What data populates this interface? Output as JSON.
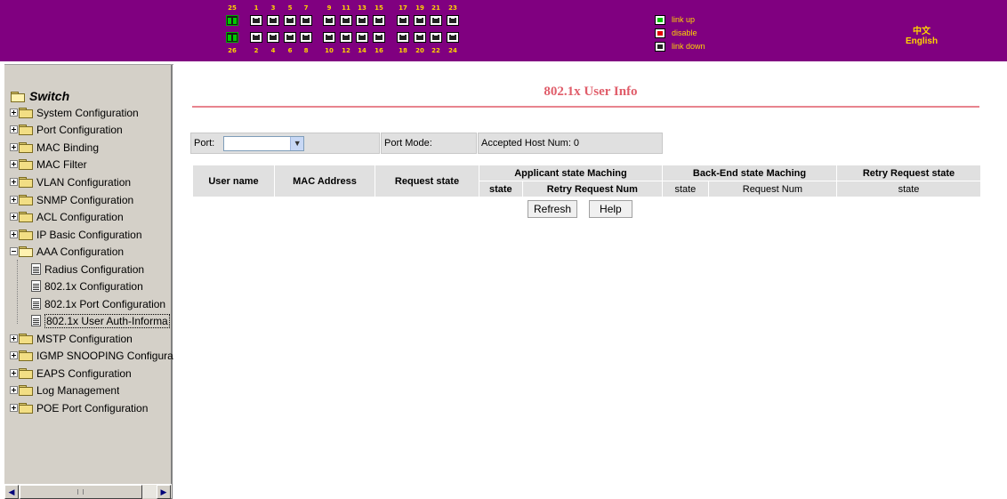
{
  "colors": {
    "banner": "#800080",
    "sidebar": "#d4d0c8",
    "title": "#e05d6a",
    "banner_text": "#ffd400"
  },
  "ports": {
    "fiber_top": "25",
    "fiber_bottom": "26",
    "top_numbers": [
      "1",
      "3",
      "5",
      "7",
      "9",
      "11",
      "13",
      "15",
      "17",
      "19",
      "21",
      "23"
    ],
    "bottom_numbers": [
      "2",
      "4",
      "6",
      "8",
      "10",
      "12",
      "14",
      "16",
      "18",
      "20",
      "22",
      "24"
    ]
  },
  "legend": [
    {
      "label": "link up",
      "icon": "port-link-up-icon",
      "color": "#00c000"
    },
    {
      "label": "disable",
      "icon": "port-disable-icon",
      "color": "#e00000"
    },
    {
      "label": "link down",
      "icon": "port-link-down-icon",
      "color": "#222222"
    }
  ],
  "language": {
    "chinese": "中文",
    "english": "English"
  },
  "sidebar": {
    "root": "Switch",
    "items": [
      {
        "label": "System Configuration"
      },
      {
        "label": "Port Configuration"
      },
      {
        "label": "MAC Binding"
      },
      {
        "label": "MAC Filter"
      },
      {
        "label": "VLAN Configuration"
      },
      {
        "label": "SNMP Configuration"
      },
      {
        "label": "ACL Configuration"
      },
      {
        "label": "IP Basic Configuration"
      },
      {
        "label": "AAA Configuration"
      },
      {
        "label": "MSTP Configuration"
      },
      {
        "label": "IGMP SNOOPING Configura"
      },
      {
        "label": "EAPS Configuration"
      },
      {
        "label": "Log Management"
      },
      {
        "label": "POE Port Configuration"
      }
    ],
    "aaa_children": [
      {
        "label": "Radius Configuration"
      },
      {
        "label": "802.1x Configuration"
      },
      {
        "label": "802.1x Port Configuration"
      },
      {
        "label": "802.1x User Auth-Informa"
      }
    ]
  },
  "main": {
    "title": "802.1x User Info",
    "port_label": "Port:",
    "port_value": "",
    "port_mode_label": "Port Mode:",
    "accepted_hosts": "Accepted Host Num: 0",
    "table": {
      "user_name": "User name",
      "mac_address": "MAC Address",
      "request_state": "Request state",
      "applicant_group": "Applicant state Maching",
      "backend_group": "Back-End state Maching",
      "retry_group": "Retry Request state",
      "sub_state": "state",
      "sub_retry_num": "Retry Request Num",
      "sub_request_num": "Request Num"
    },
    "refresh": "Refresh",
    "help": "Help"
  }
}
